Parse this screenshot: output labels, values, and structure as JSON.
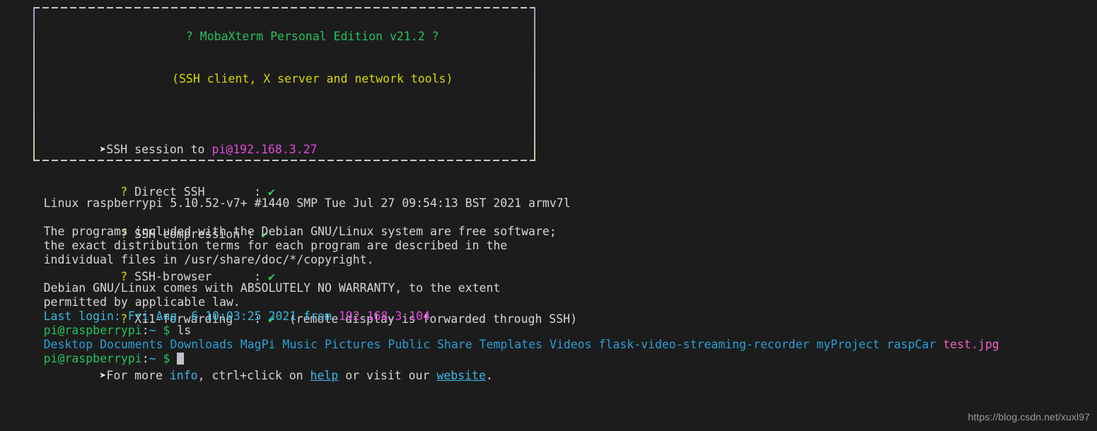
{
  "terminal": {
    "background": "#1c1c1c",
    "foreground": "#d6d6d6"
  },
  "banner": {
    "title": "? MobaXterm Personal Edition v21.2 ?",
    "subtitle": "(SSH client, X server and network tools)",
    "session": {
      "bullet": "➤",
      "prefix": "SSH session to ",
      "target": "pi@192.168.3.27"
    },
    "features": [
      {
        "bullet": "?",
        "label": "Direct SSH",
        "colon": ":",
        "check": "✔",
        "note": ""
      },
      {
        "bullet": "?",
        "label": "SSH compression",
        "colon": ":",
        "check": "✔",
        "note": ""
      },
      {
        "bullet": "?",
        "label": "SSH-browser",
        "colon": ":",
        "check": "✔",
        "note": ""
      },
      {
        "bullet": "?",
        "label": "X11-forwarding",
        "colon": ":",
        "check": "✔",
        "note": "(remote display is forwarded through SSH)"
      }
    ],
    "footer": {
      "bullet": "➤",
      "part1": "For more ",
      "link_info": "info",
      "part2": ", ctrl+click on ",
      "link_help": "help",
      "part3": " or visit our ",
      "link_website": "website",
      "part4": "."
    }
  },
  "output": {
    "kernel": "Linux raspberrypi 5.10.52-v7+ #1440 SMP Tue Jul 27 09:54:13 BST 2021 armv7l",
    "license": [
      "The programs included with the Debian GNU/Linux system are free software;",
      "the exact distribution terms for each program are described in the",
      "individual files in /usr/share/doc/*/copyright."
    ],
    "warranty": [
      "Debian GNU/Linux comes with ABSOLUTELY NO WARRANTY, to the extent",
      "permitted by applicable law."
    ],
    "last_login": {
      "label": "Last login: Fri Aug  6 10:03:25 2021 from ",
      "ip": "192.168.3.104"
    },
    "prompt": {
      "user_host": "pi@raspberrypi",
      "colon": ":",
      "path": "~",
      "symbol": "$"
    },
    "command": "ls",
    "ls_entries": [
      {
        "name": "Desktop",
        "type": "dir"
      },
      {
        "name": "Documents",
        "type": "dir"
      },
      {
        "name": "Downloads",
        "type": "dir"
      },
      {
        "name": "MagPi",
        "type": "dir"
      },
      {
        "name": "Music",
        "type": "dir"
      },
      {
        "name": "Pictures",
        "type": "dir"
      },
      {
        "name": "Public",
        "type": "dir"
      },
      {
        "name": "Share",
        "type": "dir"
      },
      {
        "name": "Templates",
        "type": "dir"
      },
      {
        "name": "Videos",
        "type": "dir"
      },
      {
        "name": "flask-video-streaming-recorder",
        "type": "dir"
      },
      {
        "name": "myProject",
        "type": "dir"
      },
      {
        "name": "raspCar",
        "type": "dir"
      },
      {
        "name": "test.jpg",
        "type": "image"
      }
    ]
  },
  "watermark": "https://blog.csdn.net/xuxl97"
}
